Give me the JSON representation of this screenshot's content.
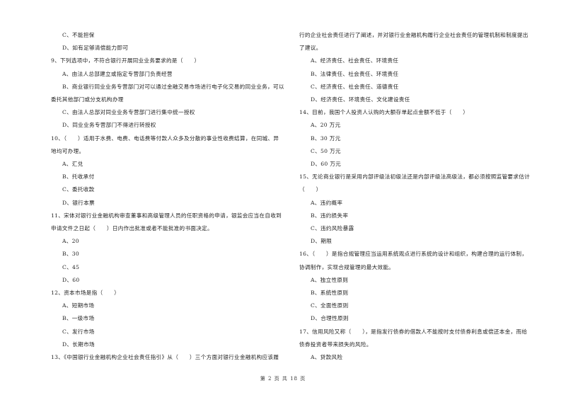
{
  "left_column": [
    {
      "text": "C、不能担保",
      "indent": true
    },
    {
      "text": "D、如有足够清偿能力即可",
      "indent": true
    },
    {
      "text": "9、下列选项中，不符合银行开展同业业务要求的是（　　）",
      "indent": false
    },
    {
      "text": "A、由法人总部建立或指定专营部门负责经营",
      "indent": true
    },
    {
      "text": "B、商业银行同业业务专营部门对可以通过金融交易市场进行电子化交易的同业业务，可以",
      "indent": true
    },
    {
      "text": "委托其他部门或分支机构办理",
      "indent": false
    },
    {
      "text": "C、由法人总部对同业业务专营部门进行集中统一授权",
      "indent": true
    },
    {
      "text": "D、同业业务专营部门不得进行转授权",
      "indent": true
    },
    {
      "text": "10、（　　）适用于水费、电费、电话费等付款人众多及分散的事业性收费结算，在同城、异",
      "indent": false
    },
    {
      "text": "地均可办理。",
      "indent": false
    },
    {
      "text": "A、汇兑",
      "indent": true
    },
    {
      "text": "B、托收承付",
      "indent": true
    },
    {
      "text": "C、委托收款",
      "indent": true
    },
    {
      "text": "D、银行本票",
      "indent": true
    },
    {
      "text": "11、宋体对银行业金融机构审查董事和高级管理人员的任职资格的申请，银监会应当在自收到",
      "indent": false
    },
    {
      "text": "申请文件之日起（　　）日内作出批准或者不能批准的书面决定。",
      "indent": false
    },
    {
      "text": "A、20",
      "indent": true
    },
    {
      "text": "B、30",
      "indent": true
    },
    {
      "text": "C、45",
      "indent": true
    },
    {
      "text": "D、60",
      "indent": true
    },
    {
      "text": "12、资本市场是指（　　）",
      "indent": false
    },
    {
      "text": "A、短期市场",
      "indent": true
    },
    {
      "text": "B、一级市场",
      "indent": true
    },
    {
      "text": "C、发行市场",
      "indent": true
    },
    {
      "text": "D、长期市场",
      "indent": true
    },
    {
      "text": "13、《中国银行业金融机构企业社会责任指引》从（　　）三个方面对银行业金融机构应该履",
      "indent": false
    }
  ],
  "right_column": [
    {
      "text": "行的企业社会责任进行了阐述，并对银行业金融机构履行企业社会责任的管理机制和制度提出",
      "indent": false
    },
    {
      "text": "了建议。",
      "indent": false
    },
    {
      "text": "A、经济责任、社会责任、环境责任",
      "indent": true
    },
    {
      "text": "B、法律责任、社会责任、环境责任",
      "indent": true
    },
    {
      "text": "C、经济责任、社会责任、道德责任",
      "indent": true
    },
    {
      "text": "D、经济责任、环境责任、文化建设责任",
      "indent": true
    },
    {
      "text": "14、目前，我国个人投资人认购的大额存单起点金额不低于（　　）",
      "indent": false
    },
    {
      "text": "A、20 万元",
      "indent": true
    },
    {
      "text": "B、30 万元",
      "indent": true
    },
    {
      "text": "C、50 万元",
      "indent": true
    },
    {
      "text": "D、60 万元",
      "indent": true
    },
    {
      "text": "15、无论商业银行是采用内部评级法初级法还是内部评级法高级法，都必须按照监管要求估计",
      "indent": false
    },
    {
      "text": "（　　）",
      "indent": false
    },
    {
      "text": "A、违约概率",
      "indent": true
    },
    {
      "text": "B、违约损失率",
      "indent": true
    },
    {
      "text": "C、违约风险暴露",
      "indent": true
    },
    {
      "text": "D、期限",
      "indent": true
    },
    {
      "text": "16、（　　）是指合规管理应当运用系统观点进行系统的设计和组织，构建合理的运行体制，",
      "indent": false
    },
    {
      "text": "协调制作，实现合规管理的最大效能。",
      "indent": false
    },
    {
      "text": "A、独立性原则",
      "indent": true
    },
    {
      "text": "B、系统性原则",
      "indent": true
    },
    {
      "text": "C、全面性原则",
      "indent": true
    },
    {
      "text": "D、合理性原则",
      "indent": true
    },
    {
      "text": "17、信用风险又称（　　），是指发行债券的借款人不能按时支付债券利息或偿还本金，而给",
      "indent": false
    },
    {
      "text": "债券投资者带来损失的风险。",
      "indent": false
    },
    {
      "text": "A、贷款风险",
      "indent": true
    }
  ],
  "footer": {
    "text": "第 2 页 共 18 页"
  }
}
